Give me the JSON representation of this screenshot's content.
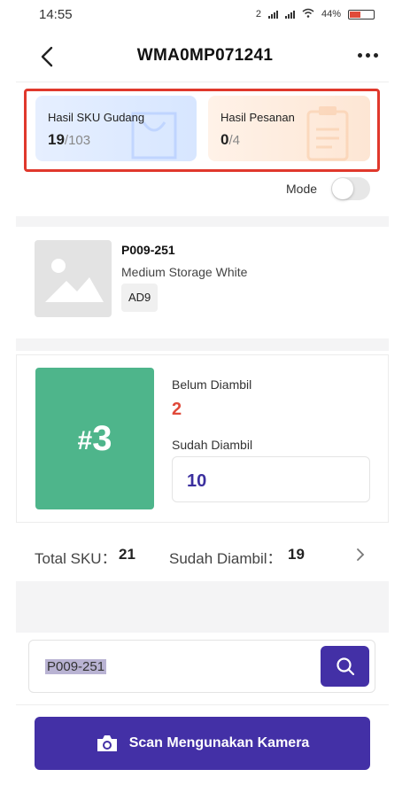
{
  "status_bar": {
    "time": "14:55",
    "network_label": "2",
    "battery": "44%"
  },
  "header": {
    "title": "WMA0MP071241"
  },
  "stats": {
    "sku": {
      "label": "Hasil SKU Gudang",
      "done": "19",
      "total": "/103"
    },
    "orders": {
      "label": "Hasil Pesanan",
      "done": "0",
      "total": "/4"
    }
  },
  "mode": {
    "label": "Mode",
    "enabled": false
  },
  "product": {
    "code": "P009-251",
    "name": "Medium Storage White",
    "location": "AD9"
  },
  "picking": {
    "bin_hash": "#",
    "bin_number": "3",
    "pending_label": "Belum Diambil",
    "pending_value": "2",
    "taken_label": "Sudah Diambil",
    "taken_value": "10"
  },
  "summary": {
    "total_sku_label": "Total SKU：",
    "total_sku_value": "21",
    "taken_label": "Sudah Diambil：",
    "taken_value": "19"
  },
  "search": {
    "value": "P009-251"
  },
  "scan_button": {
    "label": "Scan Mengunakan Kamera"
  },
  "colors": {
    "accent": "#4330a6",
    "bin_green": "#4eb58b",
    "pending_red": "#e04a3a",
    "highlight_red": "#e0382c"
  }
}
